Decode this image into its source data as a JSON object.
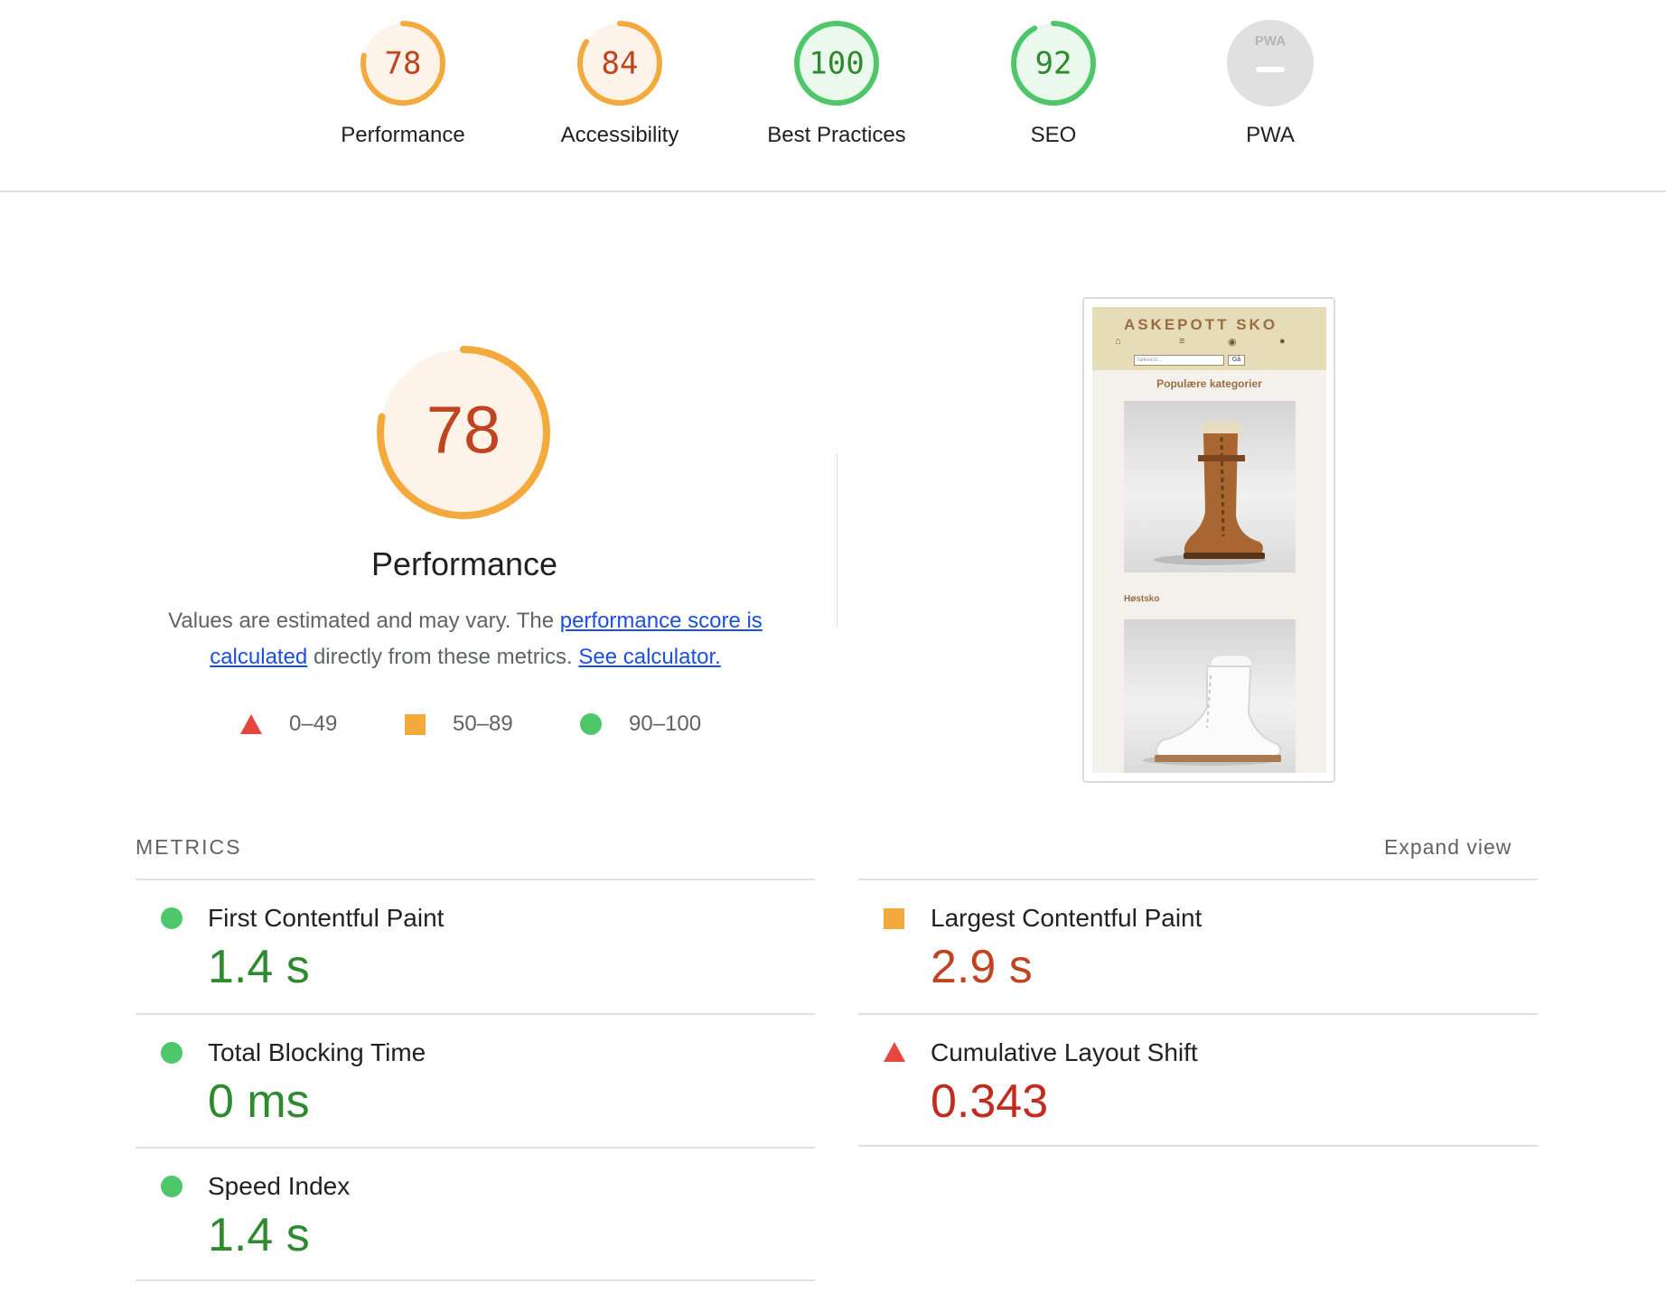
{
  "scores": [
    {
      "value": "78",
      "label": "Performance",
      "fraction": 0.78,
      "ring_color": "#f4a93d",
      "fill_color": "#fdf3e8",
      "text_color": "#c0441f"
    },
    {
      "value": "84",
      "label": "Accessibility",
      "fraction": 0.84,
      "ring_color": "#f4a93d",
      "fill_color": "#fdf3e8",
      "text_color": "#c0441f"
    },
    {
      "value": "100",
      "label": "Best Practices",
      "fraction": 1.0,
      "ring_color": "#4fc66a",
      "fill_color": "#eaf8ed",
      "text_color": "#2d8a2d"
    },
    {
      "value": "92",
      "label": "SEO",
      "fraction": 0.92,
      "ring_color": "#4fc66a",
      "fill_color": "#eaf8ed",
      "text_color": "#2d8a2d"
    },
    {
      "value": "PWA",
      "label": "PWA",
      "fraction": 0,
      "ring_color": "#e0e0e0",
      "fill_color": "#e0e0e0",
      "text_color": "#9e9e9e"
    }
  ],
  "performance": {
    "score": "78",
    "fraction": 0.78,
    "title": "Performance",
    "desc_prefix": "Values are estimated and may vary. The ",
    "link1": "performance score is calculated",
    "desc_middle": " directly from these metrics. ",
    "link2": "See calculator."
  },
  "legend": [
    {
      "range": "0–49",
      "shape": "triangle",
      "color": "#e8453c"
    },
    {
      "range": "50–89",
      "shape": "square",
      "color": "#f4a93d"
    },
    {
      "range": "90–100",
      "shape": "circle",
      "color": "#4fc66a"
    }
  ],
  "thumbnail": {
    "brand": "ASKEPOTT SKO",
    "nav_icons": [
      "home-icon",
      "menu-icon",
      "cart-icon",
      "user-icon"
    ],
    "search_placeholder": "Søkeord...",
    "search_button": "Gå",
    "heading": "Populære kategorier",
    "subheading": "Høstsko"
  },
  "metrics": {
    "title": "METRICS",
    "expand_label": "Expand view",
    "items": [
      {
        "label": "First Contentful Paint",
        "value": "1.4 s",
        "status": "pass"
      },
      {
        "label": "Largest Contentful Paint",
        "value": "2.9 s",
        "status": "average"
      },
      {
        "label": "Total Blocking Time",
        "value": "0 ms",
        "status": "pass"
      },
      {
        "label": "Cumulative Layout Shift",
        "value": "0.343",
        "status": "fail"
      },
      {
        "label": "Speed Index",
        "value": "1.4 s",
        "status": "pass"
      }
    ]
  }
}
